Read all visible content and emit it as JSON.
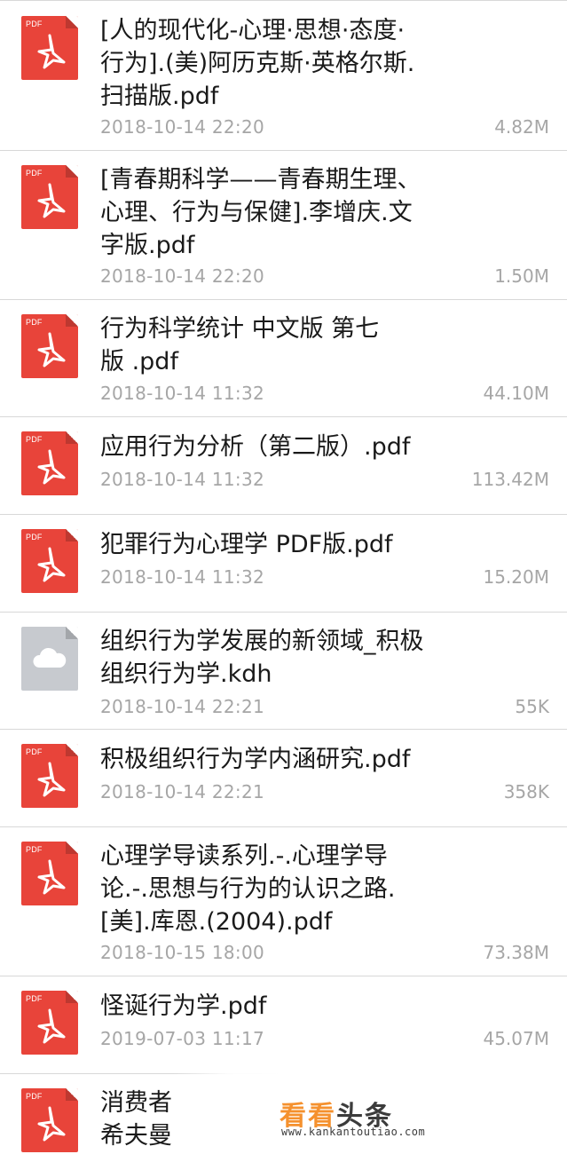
{
  "files": [
    {
      "name": "[人的现代化-心理·思想·态度·\n行为].(美)阿历克斯·英格尔斯.\n扫描版.pdf",
      "date": "2018-10-14 22:20",
      "size": "4.82M",
      "icon": "pdf-icon",
      "ext": "PDF"
    },
    {
      "name": "[青春期科学——青春期生理、\n心理、行为与保健].李增庆.文\n字版.pdf",
      "date": "2018-10-14 22:20",
      "size": "1.50M",
      "icon": "pdf-icon",
      "ext": "PDF"
    },
    {
      "name": "行为科学统计 中文版 第七\n版 .pdf",
      "date": "2018-10-14 11:32",
      "size": "44.10M",
      "icon": "pdf-icon",
      "ext": "PDF"
    },
    {
      "name": "应用行为分析（第二版）.pdf",
      "date": "2018-10-14 11:32",
      "size": "113.42M",
      "icon": "pdf-icon",
      "ext": "PDF"
    },
    {
      "name": "犯罪行为心理学 PDF版.pdf",
      "date": "2018-10-14 11:32",
      "size": "15.20M",
      "icon": "pdf-icon",
      "ext": "PDF"
    },
    {
      "name": "组织行为学发展的新领域_积极\n组织行为学.kdh",
      "date": "2018-10-14 22:21",
      "size": "55K",
      "icon": "cloud-icon",
      "ext": ""
    },
    {
      "name": "积极组织行为学内涵研究.pdf",
      "date": "2018-10-14 22:21",
      "size": "358K",
      "icon": "pdf-icon",
      "ext": "PDF"
    },
    {
      "name": "心理学导读系列.-.心理学导\n论.-.思想与行为的认识之路.\n[美].库恩.(2004).pdf",
      "date": "2018-10-15 18:00",
      "size": "73.38M",
      "icon": "pdf-icon",
      "ext": "PDF"
    },
    {
      "name": "怪诞行为学.pdf",
      "date": "2019-07-03 11:17",
      "size": "45.07M",
      "icon": "pdf-icon",
      "ext": "PDF"
    },
    {
      "name": "消费者\n希夫曼",
      "date": "",
      "size": "",
      "icon": "pdf-icon",
      "ext": "PDF"
    }
  ],
  "watermark": {
    "part_a": "看看",
    "part_b": "头条",
    "url": "www.kankantoutiao.com"
  },
  "colors": {
    "pdf_red": "#e8443a",
    "cloud_gray": "#c7cacf",
    "meta_gray": "#a6a6a6",
    "divider": "#d8d8d8",
    "watermark_orange": "#f5912e"
  }
}
